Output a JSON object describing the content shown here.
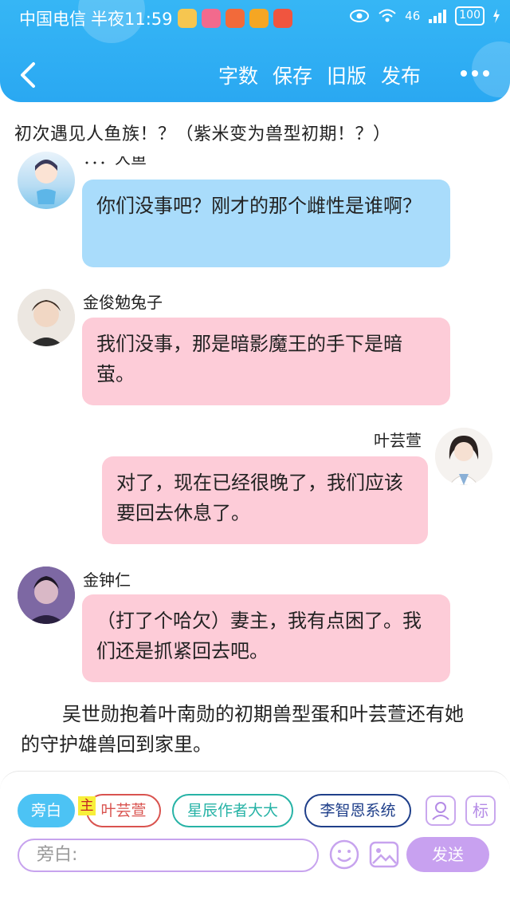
{
  "status_bar": {
    "carrier": "中国电信",
    "time": "半夜11:59",
    "network": "46",
    "battery": "100"
  },
  "nav": {
    "back_icon": "chevron-left-icon",
    "actions": [
      "字数",
      "保存",
      "旧版",
      "发布"
    ],
    "more_icon": "more-dots-icon"
  },
  "chapter_title": "初次遇见人鱼族！？（紫米变为兽型初期！？）",
  "messages": [
    {
      "sender": "：：：大鱼",
      "text": "你们没事吧？刚才的那个雌性是谁啊？",
      "color": "#a9dcfb"
    },
    {
      "sender": "金俊勉兔子",
      "text": "我们没事，那是暗影魔王的手下是暗萤。",
      "color": "#fdccd8"
    },
    {
      "sender": "叶芸萱",
      "text": "对了，现在已经很晚了，我们应该要回去休息了。",
      "color": "#fdccd8"
    },
    {
      "sender": "金钟仁",
      "text": "（打了个哈欠）妻主，我有点困了。我们还是抓紧回去吧。",
      "color": "#fdccd8"
    }
  ],
  "narration": "吴世勋抱着叶南勋的初期兽型蛋和叶芸萱还有她的守护雄兽回到家里。",
  "bottom_bar": {
    "roles": [
      {
        "label": "旁白",
        "selected": true
      },
      {
        "label": "叶芸萱",
        "color": "#d9534f"
      },
      {
        "label": "星辰作者大大",
        "color": "#27b3a6"
      },
      {
        "label": "李智恩系统",
        "color": "#1f3f8a"
      }
    ],
    "role_badge": "主",
    "contact_icon": "person-icon",
    "tag_button": "标",
    "input_placeholder": "旁白:",
    "emoji_icon": "smiley-icon",
    "image_icon": "image-icon",
    "send_label": "发送"
  }
}
